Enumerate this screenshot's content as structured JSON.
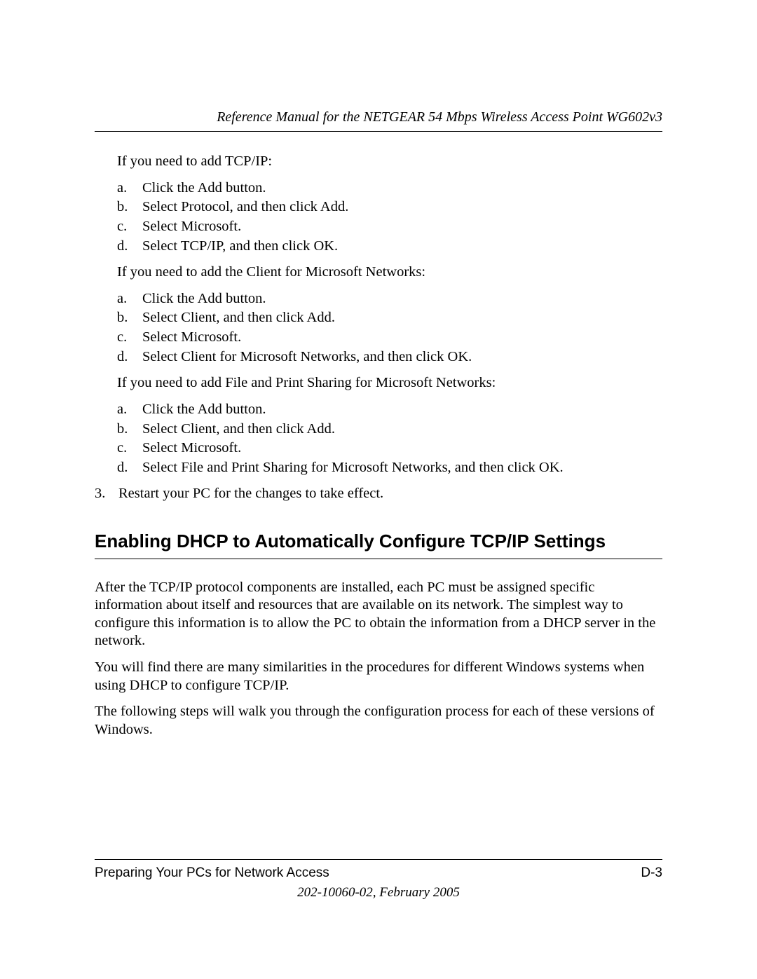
{
  "header": {
    "running_title": "Reference Manual for the NETGEAR 54 Mbps Wireless Access Point WG602v3"
  },
  "body": {
    "p1": "If you need to add TCP/IP:",
    "list1": {
      "a": "Click the Add button.",
      "b": "Select Protocol, and then click Add.",
      "c": "Select Microsoft.",
      "d": "Select TCP/IP, and then click OK."
    },
    "p2": "If you need to add the Client for Microsoft Networks:",
    "list2": {
      "a": "Click the Add button.",
      "b": "Select Client, and then click Add.",
      "c": "Select Microsoft.",
      "d": "Select Client for Microsoft Networks, and then click OK."
    },
    "p3": "If you need to add File and Print Sharing for Microsoft Networks:",
    "list3": {
      "a": "Click the Add button.",
      "b": "Select Client, and then click Add.",
      "c": "Select Microsoft.",
      "d": "Select File and Print Sharing for Microsoft Networks, and then click OK."
    },
    "numbered": {
      "n3_label": "3.",
      "n3_text": "Restart your PC for the changes to take effect."
    },
    "heading": "Enabling DHCP to Automatically Configure TCP/IP Settings",
    "p4": "After the TCP/IP protocol components are installed, each PC must be assigned specific information about itself and resources that are available on its network. The simplest way to configure this information is to allow the PC to obtain the information from a DHCP server in the network.",
    "p5": "You will find there are many similarities in the procedures for different Windows systems when using DHCP to configure TCP/IP.",
    "p6": "The following steps will walk you through the configuration process for each of these versions of Windows."
  },
  "labels": {
    "a": "a.",
    "b": "b.",
    "c": "c.",
    "d": "d."
  },
  "footer": {
    "section_title": "Preparing Your PCs for Network Access",
    "page_number": "D-3",
    "doc_info": "202-10060-02, February 2005"
  }
}
